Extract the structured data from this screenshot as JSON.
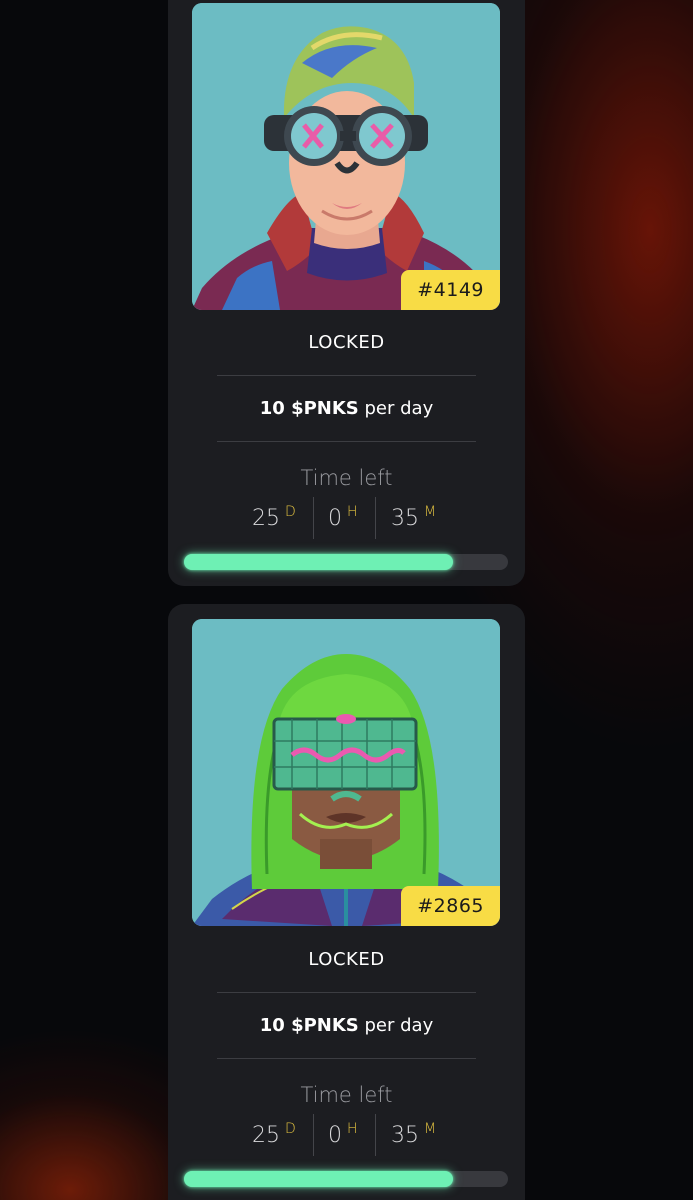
{
  "cards": [
    {
      "token_id": "#4149",
      "status": "LOCKED",
      "rate_amount": "10 $PNKS",
      "rate_suffix": " per day",
      "time_left_label": "Time left",
      "countdown": {
        "days": "25",
        "days_unit": "D",
        "hours": "0",
        "hours_unit": "H",
        "minutes": "35",
        "minutes_unit": "M"
      },
      "progress_fraction": 0.83,
      "artwork": "punk-goggles-avatar",
      "background_color": "#6cbcc3"
    },
    {
      "token_id": "#2865",
      "status": "LOCKED",
      "rate_amount": "10 $PNKS",
      "rate_suffix": " per day",
      "time_left_label": "Time left",
      "countdown": {
        "days": "25",
        "days_unit": "D",
        "hours": "0",
        "hours_unit": "H",
        "minutes": "35",
        "minutes_unit": "M"
      },
      "progress_fraction": 0.83,
      "artwork": "green-bob-visor-avatar",
      "background_color": "#6cbcc3"
    }
  ],
  "colors": {
    "badge": "#f8dc45",
    "progress": "#6ef0b4",
    "unit": "#e0c040",
    "card": "#1c1d21"
  }
}
